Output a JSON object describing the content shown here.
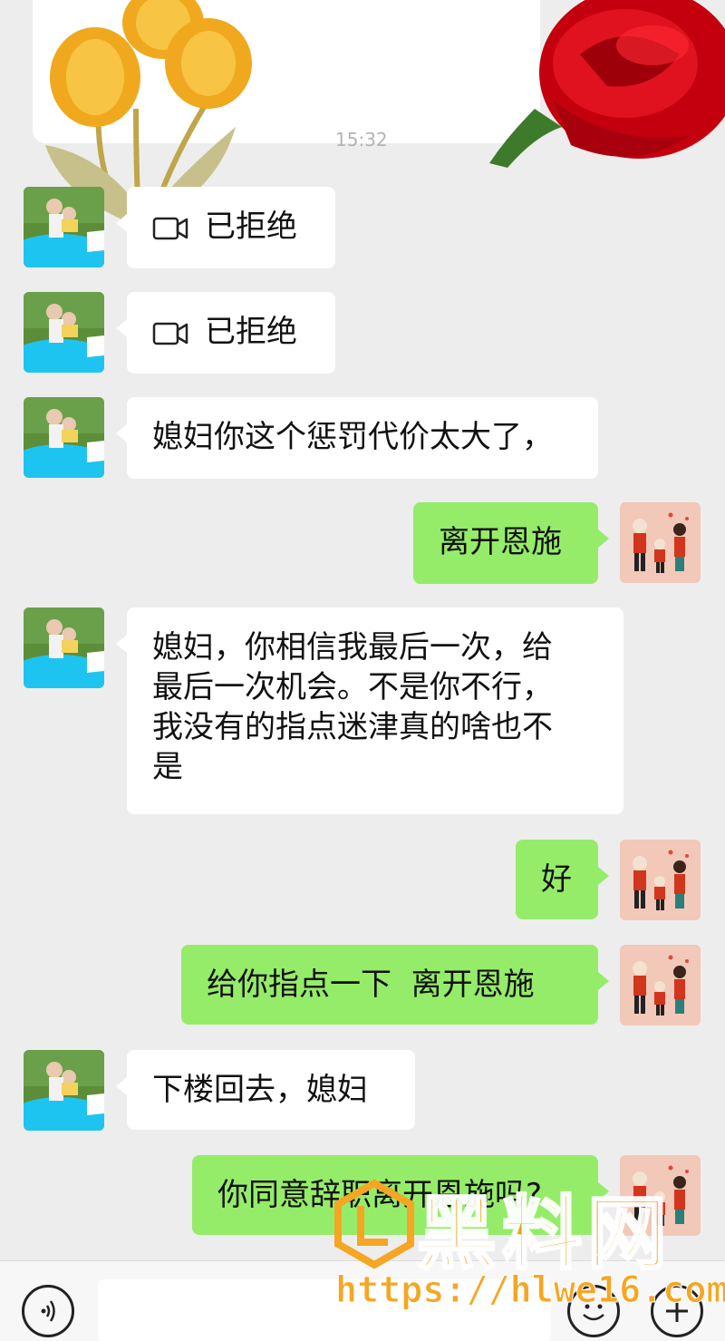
{
  "header_card": {
    "time_fragment": "15:32"
  },
  "messages": [
    {
      "side": "in",
      "type": "video-call",
      "text": "已拒绝"
    },
    {
      "side": "in",
      "type": "video-call",
      "text": "已拒绝"
    },
    {
      "side": "in",
      "type": "text",
      "text": "媳妇你这个惩罚代价太大了，"
    },
    {
      "side": "out",
      "type": "text",
      "text": "离开恩施"
    },
    {
      "side": "in",
      "type": "text",
      "lines": [
        "媳妇，你相信我最后一次，给",
        "最后一次机会。不是你不行，",
        "我没有的指点迷津真的啥也不",
        "是"
      ]
    },
    {
      "side": "out",
      "type": "text",
      "text": "好"
    },
    {
      "side": "out",
      "type": "text",
      "text": "给你指点一下  离开恩施"
    },
    {
      "side": "in",
      "type": "text",
      "text": "下楼回去，媳妇"
    },
    {
      "side": "out",
      "type": "text",
      "text": "你同意辞职离开恩施吗?"
    }
  ],
  "input_bar": {
    "voice_icon": "voice-icon",
    "emoji_icon": "emoji-icon",
    "plus_icon": "plus-icon"
  },
  "watermark": {
    "brand": "黑料网",
    "url": "https://hlwe16.com"
  },
  "colors": {
    "background": "#ededed",
    "outgoing": "#95ec69",
    "incoming": "#ffffff"
  }
}
